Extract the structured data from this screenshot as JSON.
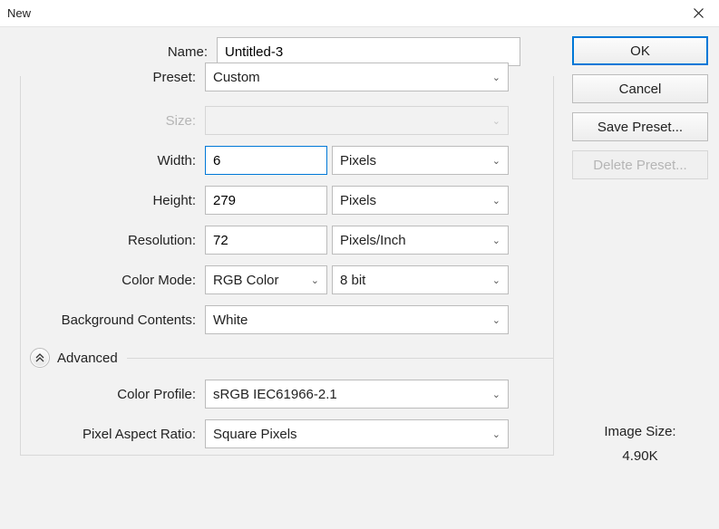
{
  "window": {
    "title": "New"
  },
  "labels": {
    "name": "Name:",
    "preset": "Preset:",
    "size": "Size:",
    "width": "Width:",
    "height": "Height:",
    "resolution": "Resolution:",
    "color_mode": "Color Mode:",
    "bg_contents": "Background Contents:",
    "advanced": "Advanced",
    "color_profile": "Color Profile:",
    "pixel_aspect": "Pixel Aspect Ratio:"
  },
  "values": {
    "name": "Untitled-3",
    "preset": "Custom",
    "size": "",
    "width": "6",
    "width_unit": "Pixels",
    "height": "279",
    "height_unit": "Pixels",
    "resolution": "72",
    "resolution_unit": "Pixels/Inch",
    "color_mode": "RGB Color",
    "bit_depth": "8 bit",
    "bg_contents": "White",
    "color_profile": "sRGB IEC61966-2.1",
    "pixel_aspect": "Square Pixels"
  },
  "buttons": {
    "ok": "OK",
    "cancel": "Cancel",
    "save_preset": "Save Preset...",
    "delete_preset": "Delete Preset..."
  },
  "info": {
    "image_size_label": "Image Size:",
    "image_size_value": "4.90K"
  }
}
